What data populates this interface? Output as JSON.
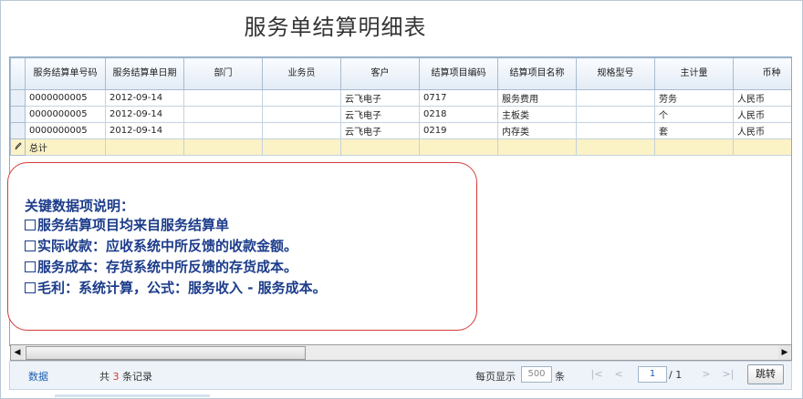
{
  "report": {
    "title": "服务单结算明细表"
  },
  "table": {
    "columns": [
      "服务结算单号码",
      "服务结算单日期",
      "部门",
      "业务员",
      "客户",
      "结算项目编码",
      "结算项目名称",
      "规格型号",
      "主计量",
      "币种"
    ],
    "rows": [
      [
        "0000000005",
        "2012-09-14",
        "",
        "",
        "云飞电子",
        "0717",
        "服务费用",
        "",
        "劳务",
        "人民币"
      ],
      [
        "0000000005",
        "2012-09-14",
        "",
        "",
        "云飞电子",
        "0218",
        "主板类",
        "",
        "个",
        "人民币"
      ],
      [
        "0000000005",
        "2012-09-14",
        "",
        "",
        "云飞电子",
        "0219",
        "内存类",
        "",
        "套",
        "人民币"
      ]
    ],
    "total_label": "总计",
    "total_row_icon": "pencil-icon"
  },
  "callout": {
    "heading": "关键数据项说明：",
    "items": [
      "服务结算项目均来自服务结算单",
      "实际收款：应收系统中所反馈的收款金额。",
      "服务成本：存货系统中所反馈的存货成本。",
      "毛利：系统计算，公式：服务收入 - 服务成本。"
    ],
    "border_color": "#d43a3a",
    "text_color": "#1c3c8a"
  },
  "pager": {
    "data_link": "数据",
    "record_prefix": "共",
    "record_count": "3",
    "record_suffix": "条记录",
    "page_size_label": "每页显示",
    "page_size": "500",
    "page_size_unit": "条",
    "current_page": "1",
    "total_pages_label": "/ 1",
    "jump_label": "跳转"
  }
}
